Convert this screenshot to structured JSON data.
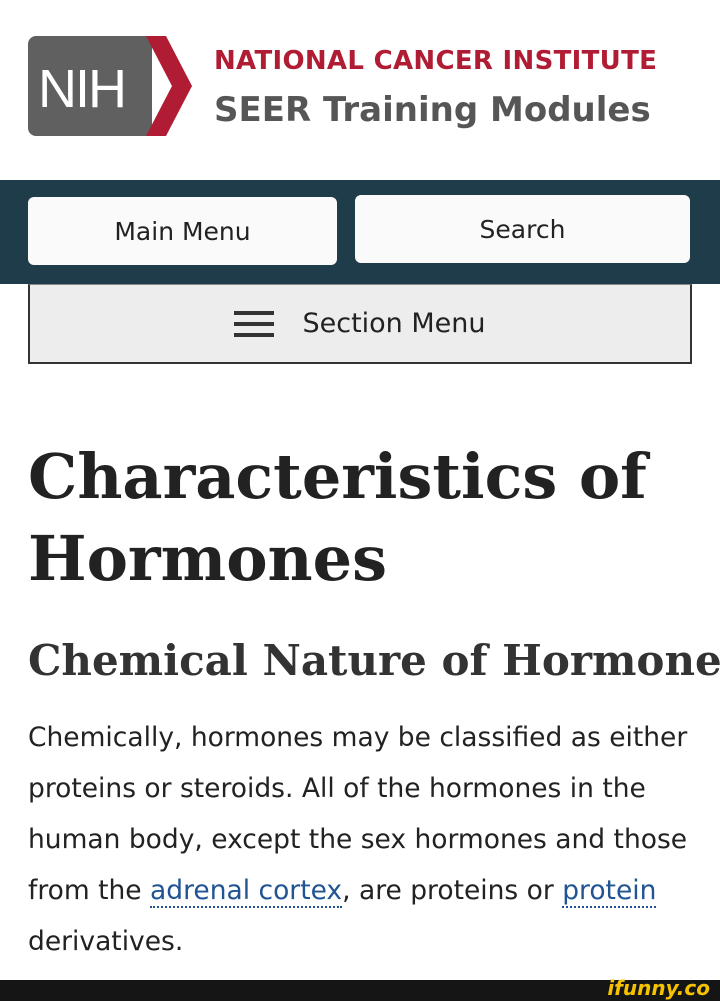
{
  "header": {
    "logo_text": "NIH",
    "organization": "NATIONAL CANCER INSTITUTE",
    "product": "SEER Training Modules",
    "colors": {
      "brand_red": "#b01c34",
      "logo_gray": "#606060"
    }
  },
  "nav": {
    "main_menu_label": "Main Menu",
    "search_label": "Search",
    "background": "#1e3c4a"
  },
  "section_menu": {
    "icon": "hamburger-menu-icon",
    "label": "Section Menu"
  },
  "content": {
    "title": "Characteristics of Hormones",
    "heading": "Chemical Nature of Hormones",
    "paragraph": {
      "part1": "Chemically, hormones may be classified as either proteins or steroids. All of the hormones in the human body, except the sex hormones and those from the ",
      "link1": "adrenal cortex",
      "part2": ", are proteins or ",
      "link2": "protein",
      "part3": " derivatives."
    },
    "link_color": "#205493"
  },
  "footer": {
    "watermark": "ifunny.co"
  }
}
